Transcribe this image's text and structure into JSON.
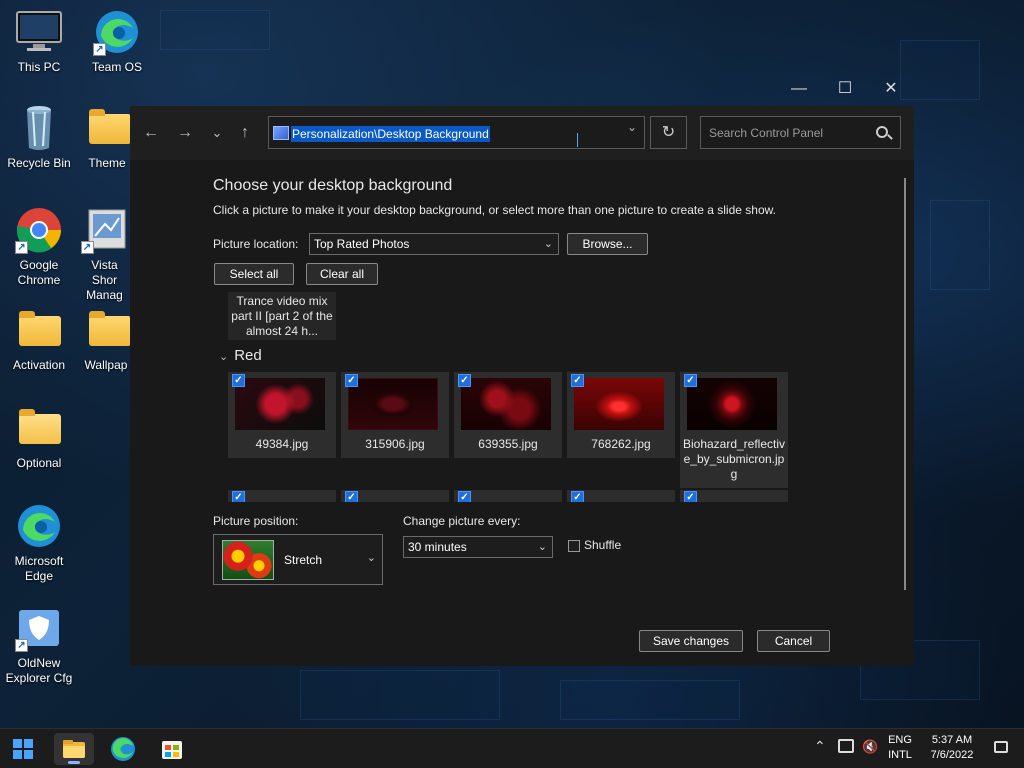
{
  "desktop": {
    "icons": [
      {
        "label": "This PC"
      },
      {
        "label": "Team OS"
      },
      {
        "label": "Recycle Bin"
      },
      {
        "label": "Theme"
      },
      {
        "label": "Google Chrome"
      },
      {
        "label": "Vista Shor Manag"
      },
      {
        "label": "Activation"
      },
      {
        "label": "Wallpap"
      },
      {
        "label": "Optional"
      },
      {
        "label": "Microsoft Edge"
      },
      {
        "label": "OldNew Explorer Cfg"
      }
    ]
  },
  "window": {
    "controls": {
      "minimize": "—",
      "maximize": "☐",
      "close": "✕"
    },
    "nav": {
      "back": "←",
      "forward": "→",
      "recent": "⌄",
      "up": "↑",
      "refresh": "↻"
    },
    "address": "Personalization\\Desktop Background",
    "search_placeholder": "Search Control Panel",
    "title": "Choose your desktop background",
    "subtitle": "Click a picture to make it your desktop background, or select more than one picture to create a slide show.",
    "picture_location_label": "Picture location:",
    "picture_location_value": "Top Rated Photos",
    "browse_label": "Browse...",
    "select_all_label": "Select all",
    "clear_all_label": "Clear all",
    "previous_item_caption": "Trance video mix part II [part 2 of the almost 24 h...",
    "group_name": "Red",
    "thumbnails": [
      {
        "caption": "49384.jpg",
        "checked": true
      },
      {
        "caption": "315906.jpg",
        "checked": true
      },
      {
        "caption": "639355.jpg",
        "checked": true
      },
      {
        "caption": "768262.jpg",
        "checked": true
      },
      {
        "caption": "Biohazard_reflective_by_submicron.jpg",
        "checked": true
      }
    ],
    "picture_position_label": "Picture position:",
    "picture_position_value": "Stretch",
    "change_every_label": "Change picture every:",
    "change_every_value": "30 minutes",
    "shuffle_label": "Shuffle",
    "shuffle_checked": false,
    "save_label": "Save changes",
    "cancel_label": "Cancel"
  },
  "taskbar": {
    "language_line1": "ENG",
    "language_line2": "INTL",
    "time": "5:37 AM",
    "date": "7/6/2022"
  },
  "icons": [
    "monitor-icon",
    "edge-icon",
    "recycle-bin-icon",
    "folder-icon",
    "chrome-icon",
    "shield-icon",
    "windows-start-icon",
    "file-explorer-icon",
    "store-icon",
    "chevron-up-icon",
    "network-icon",
    "volume-icon",
    "notification-icon",
    "search-icon"
  ],
  "colors": {
    "accent": "#0a59c7",
    "checkbox": "#1e6fd9",
    "window_bg": "#191919",
    "taskbar_bg": "#1c1c1c"
  }
}
